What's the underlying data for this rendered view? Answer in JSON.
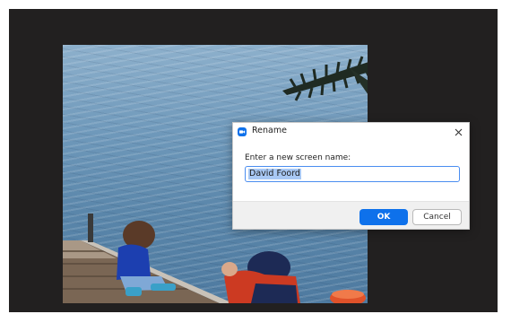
{
  "dialog": {
    "title": "Rename",
    "prompt": "Enter a new screen name:",
    "name_value": "David Foord",
    "ok_label": "OK",
    "cancel_label": "Cancel",
    "icons": {
      "app": "zoom-camera-icon",
      "close": "close-icon"
    }
  },
  "colors": {
    "accent": "#0e71eb",
    "input_border": "#4a8df0",
    "selection": "#a8c8f4",
    "backdrop": "#222020"
  }
}
